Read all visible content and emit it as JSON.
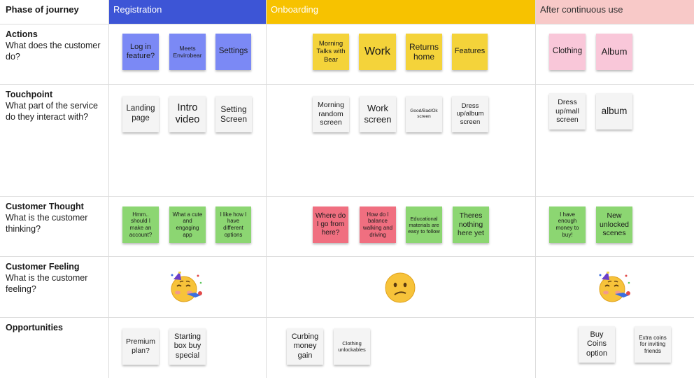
{
  "header": {
    "phase_label": "Phase of journey",
    "phases": [
      {
        "label": "Registration",
        "color": "#3d55d6"
      },
      {
        "label": "Onboarding",
        "color": "#f7c200"
      },
      {
        "label": "After continuous use",
        "color": "#f8c9c8"
      }
    ]
  },
  "rows": [
    {
      "title": "Actions",
      "question": "What does the customer do?"
    },
    {
      "title": "Touchpoint",
      "question": "What part of the service do they interact with?"
    },
    {
      "title": "Customer Thought",
      "question": "What is the customer thinking?"
    },
    {
      "title": "Customer Feeling",
      "question": "What is the customer feeling?"
    },
    {
      "title": "Opportunities",
      "question": ""
    }
  ],
  "stickies": {
    "actions": [
      "Log in feature?",
      "Meets Envirobear",
      "Settings",
      "Morning Talks with Bear",
      "Work",
      "Returns home",
      "Features",
      "Clothing",
      "Album"
    ],
    "touchpoint": [
      "Landing page",
      "Intro video",
      "Setting Screen",
      "Morning random screen",
      "Work screen",
      "Good/Bad/Ok screen",
      "Dress up/album screen",
      "Dress up/mall screen",
      "album"
    ],
    "thought": [
      "Hmm.. should I make an account?",
      "What a cute and engaging app",
      "I like how I have different options",
      "Where do I go from here?",
      "How do I balance walking and driving",
      "Educational materials are easy to follow",
      "Theres nothing here yet",
      "I have enough money to buy!",
      "New unlocked scenes"
    ],
    "opportunities": [
      "Premium plan?",
      "Starting box buy special",
      "Curbing money gain",
      "Clothing unlockables",
      "Buy Coins option",
      "Extra coins for inviting friends"
    ]
  },
  "feelings": [
    "party-face-emoji",
    "confused-face-emoji",
    "party-face-emoji"
  ]
}
